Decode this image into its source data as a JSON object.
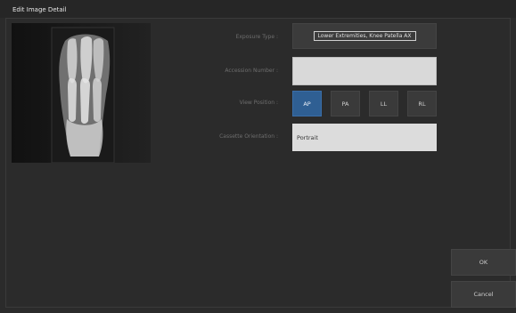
{
  "window": {
    "title": "Edit Image Detail"
  },
  "form": {
    "exposure_type_label": "Exposure Type :",
    "exposure_type_value": "Lower Extremities, Knee Patella AX",
    "accession_number_label": "Accession Number :",
    "accession_number_value": "",
    "view_position_label": "View Position :",
    "view_positions": [
      "AP",
      "PA",
      "LL",
      "RL"
    ],
    "view_position_selected": "AP",
    "cassette_orientation_label": "Cassette Orientation :",
    "cassette_orientation_value": "Portrait"
  },
  "actions": {
    "ok": "OK",
    "cancel": "Cancel"
  },
  "colors": {
    "selected": "#2f5f93",
    "background": "#2b2b2b",
    "button": "#3a3a3a"
  },
  "image": {
    "subject": "foot x-ray"
  }
}
